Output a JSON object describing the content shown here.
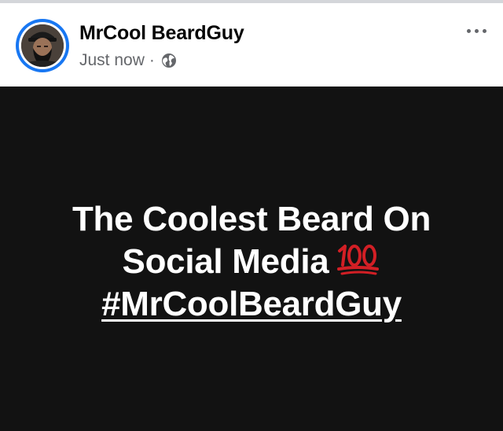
{
  "post": {
    "author": {
      "name": "MrCool BeardGuy",
      "avatar_icon": "user-avatar-photo"
    },
    "meta": {
      "timestamp": "Just now",
      "separator": "·",
      "audience_icon": "globe-icon"
    },
    "menu_icon": "more-horizontal-icon",
    "status": {
      "line1": "The Coolest Beard On",
      "line2": "Social Media",
      "emoji": "💯",
      "emoji_icon": "hundred-points-icon",
      "hashtag": "#MrCoolBeardGuy"
    },
    "colors": {
      "header_background": "#ffffff",
      "body_background": "#121212",
      "status_text": "#ffffff",
      "name_text": "#050505",
      "meta_text": "#65676b",
      "avatar_ring": "#1877f2",
      "emoji_red": "#d21f25"
    }
  }
}
